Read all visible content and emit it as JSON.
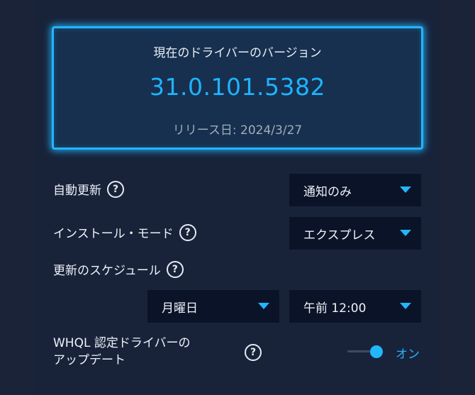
{
  "version_card": {
    "title": "現在のドライバーのバージョン",
    "version": "31.0.101.5382",
    "release": "リリース日: 2024/3/27"
  },
  "auto_update": {
    "label": "自動更新",
    "value": "通知のみ"
  },
  "install_mode": {
    "label": "インストール・モード",
    "value": "エクスプレス"
  },
  "schedule": {
    "label": "更新のスケジュール",
    "day": "月曜日",
    "time": "午前 12:00"
  },
  "whql": {
    "label_line1": "WHQL 認定ドライバーの",
    "label_line2": "アップデート",
    "state": "オン",
    "enabled": true
  },
  "help_glyph": "?",
  "colors": {
    "accent": "#22b6ff",
    "background": "#1a2337",
    "dropdown": "#0b1328"
  },
  "icons": {
    "help": "question-circle-icon",
    "dropdown": "chevron-down-icon"
  }
}
